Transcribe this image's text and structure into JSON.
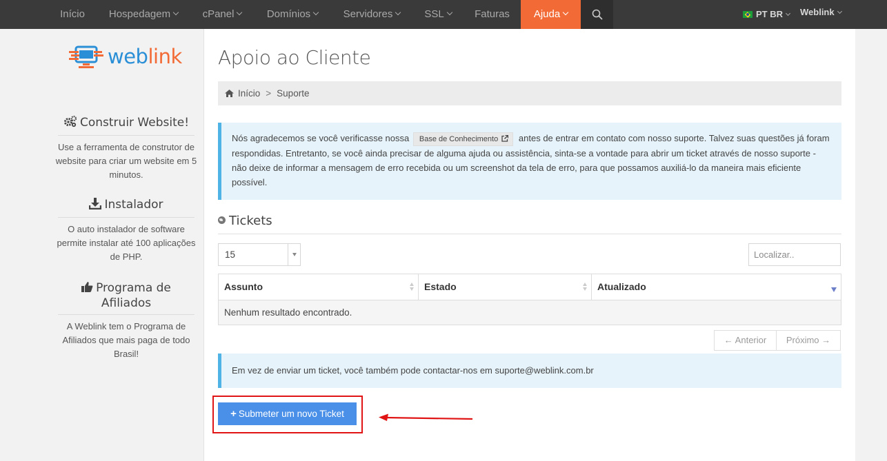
{
  "nav": {
    "items": [
      {
        "label": "Início",
        "has_dropdown": false
      },
      {
        "label": "Hospedagem",
        "has_dropdown": true
      },
      {
        "label": "cPanel",
        "has_dropdown": true
      },
      {
        "label": "Domínios",
        "has_dropdown": true
      },
      {
        "label": "Servidores",
        "has_dropdown": true
      },
      {
        "label": "SSL",
        "has_dropdown": true
      },
      {
        "label": "Faturas",
        "has_dropdown": false
      },
      {
        "label": "Ajuda",
        "has_dropdown": true,
        "active": true
      }
    ],
    "search_icon": "search-icon",
    "language": "PT BR",
    "user": "Weblink"
  },
  "sidebar": {
    "logo_text_a": "web",
    "logo_text_b": "link",
    "blocks": [
      {
        "icon": "gears-icon",
        "title": "Construir Website!",
        "text": "Use a ferramenta de construtor de website para criar um website em 5 minutos."
      },
      {
        "icon": "download-icon",
        "title": "Instalador",
        "text": "O auto instalador de software permite instalar até 100 aplicações de PHP."
      },
      {
        "icon": "thumbs-up-icon",
        "title": "Programa de Afiliados",
        "text": "A Weblink tem o Programa de Afiliados que mais paga de todo Brasil!"
      }
    ]
  },
  "main": {
    "page_title": "Apoio ao Cliente",
    "breadcrumb": [
      "Início",
      "Suporte"
    ],
    "alert_intro": "Nós agradecemos se você verificasse nossa",
    "kb_button": "Base de Conhecimento",
    "alert_rest": "antes de entrar em contato com nosso suporte. Talvez suas questões já foram respondidas. Entretanto, se você ainda precisar de alguma ajuda ou assistência, sinta-se a vontade para abrir um ticket através de nosso suporte - não deixe de informar a mensagem de erro recebida ou um screenshot da tela de erro, para que possamos auxiliá-lo da maneira mais eficiente possível.",
    "tickets_heading": "Tickets",
    "page_size": "15",
    "search_placeholder": "Localizar..",
    "table": {
      "columns": [
        "Assunto",
        "Estado",
        "Atualizado"
      ],
      "empty_message": "Nenhum resultado encontrado."
    },
    "pager": {
      "prev": "← Anterior",
      "next": "Próximo →"
    },
    "contact_alert": "Em vez de enviar um ticket, você também pode contactar-nos em suporte@weblink.com.br",
    "submit_button": "Submeter um novo Ticket"
  },
  "colors": {
    "nav_bg": "#3a3a3a",
    "accent": "#f26b36",
    "primary_button": "#4a90e8",
    "info_border": "#4fb3e5",
    "highlight": "#e01414"
  }
}
